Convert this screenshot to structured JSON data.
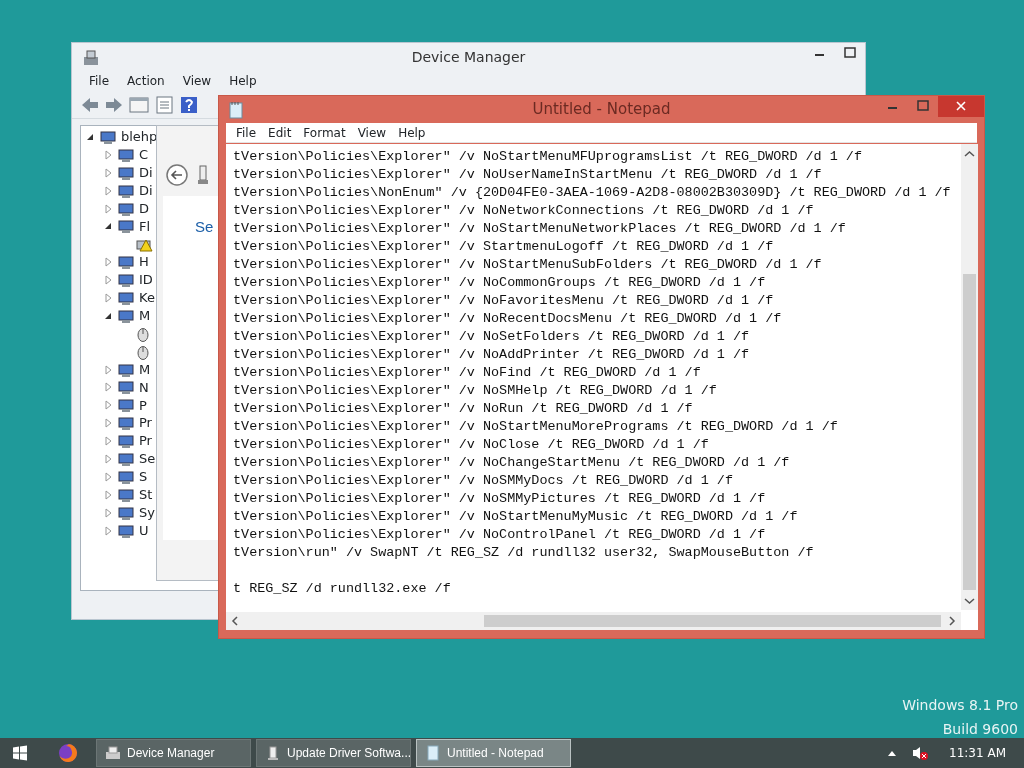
{
  "device_manager": {
    "title": "Device Manager",
    "menu": [
      "File",
      "Action",
      "View",
      "Help"
    ],
    "tree": {
      "label": "blehp",
      "expanded": true,
      "children": [
        {
          "label": "C",
          "expanded": false
        },
        {
          "label": "Di",
          "expanded": false
        },
        {
          "label": "Di",
          "expanded": false
        },
        {
          "label": "D",
          "expanded": false
        },
        {
          "label": "Fl",
          "expanded": true,
          "children": [
            {
              "kind": "warning"
            }
          ]
        },
        {
          "label": "H",
          "expanded": false
        },
        {
          "label": "ID",
          "expanded": false
        },
        {
          "label": "Ke",
          "expanded": false
        },
        {
          "label": "M",
          "expanded": true,
          "children": [
            {
              "kind": "mouse"
            },
            {
              "kind": "mouse"
            }
          ]
        },
        {
          "label": "M",
          "expanded": false
        },
        {
          "label": "N",
          "expanded": false
        },
        {
          "label": "P",
          "expanded": false
        },
        {
          "label": "Pr",
          "expanded": false
        },
        {
          "label": "Pr",
          "expanded": false
        },
        {
          "label": "Se",
          "expanded": false
        },
        {
          "label": "S",
          "expanded": false
        },
        {
          "label": "St",
          "expanded": false
        },
        {
          "label": "Sy",
          "expanded": false
        },
        {
          "label": "U",
          "expanded": false
        }
      ]
    }
  },
  "update_driver": {
    "heading": "Se"
  },
  "notepad": {
    "title": "Untitled - Notepad",
    "menu": [
      "File",
      "Edit",
      "Format",
      "View",
      "Help"
    ],
    "lines": [
      "tVersion\\Policies\\Explorer\" /v NoStartMenuMFUprogramsList /t REG_DWORD /d 1 /f",
      "tVersion\\Policies\\Explorer\" /v NoUserNameInStartMenu /t REG_DWORD /d 1 /f",
      "tVersion\\Policies\\NonEnum\" /v {20D04FE0-3AEA-1069-A2D8-08002B30309D} /t REG_DWORD /d 1 /f",
      "tVersion\\Policies\\Explorer\" /v NoNetworkConnections /t REG_DWORD /d 1 /f",
      "tVersion\\Policies\\Explorer\" /v NoStartMenuNetworkPlaces /t REG_DWORD /d 1 /f",
      "tVersion\\Policies\\Explorer\" /v StartmenuLogoff /t REG_DWORD /d 1 /f",
      "tVersion\\Policies\\Explorer\" /v NoStartMenuSubFolders /t REG_DWORD /d 1 /f",
      "tVersion\\Policies\\Explorer\" /v NoCommonGroups /t REG_DWORD /d 1 /f",
      "tVersion\\Policies\\Explorer\" /v NoFavoritesMenu /t REG_DWORD /d 1 /f",
      "tVersion\\Policies\\Explorer\" /v NoRecentDocsMenu /t REG_DWORD /d 1 /f",
      "tVersion\\Policies\\Explorer\" /v NoSetFolders /t REG_DWORD /d 1 /f",
      "tVersion\\Policies\\Explorer\" /v NoAddPrinter /t REG_DWORD /d 1 /f",
      "tVersion\\Policies\\Explorer\" /v NoFind /t REG_DWORD /d 1 /f",
      "tVersion\\Policies\\Explorer\" /v NoSMHelp /t REG_DWORD /d 1 /f",
      "tVersion\\Policies\\Explorer\" /v NoRun /t REG_DWORD /d 1 /f",
      "tVersion\\Policies\\Explorer\" /v NoStartMenuMorePrograms /t REG_DWORD /d 1 /f",
      "tVersion\\Policies\\Explorer\" /v NoClose /t REG_DWORD /d 1 /f",
      "tVersion\\Policies\\Explorer\" /v NoChangeStartMenu /t REG_DWORD /d 1 /f",
      "tVersion\\Policies\\Explorer\" /v NoSMMyDocs /t REG_DWORD /d 1 /f",
      "tVersion\\Policies\\Explorer\" /v NoSMMyPictures /t REG_DWORD /d 1 /f",
      "tVersion\\Policies\\Explorer\" /v NoStartMenuMyMusic /t REG_DWORD /d 1 /f",
      "tVersion\\Policies\\Explorer\" /v NoControlPanel /t REG_DWORD /d 1 /f",
      "tVersion\\run\" /v SwapNT /t REG_SZ /d rundll32 user32, SwapMouseButton /f",
      {
        "kind": "blank"
      },
      "t REG_SZ /d rundll32.exe /f"
    ]
  },
  "desktop": {
    "edition": "Windows 8.1 Pro",
    "build": "Build 9600"
  },
  "taskbar": {
    "buttons": [
      {
        "label": "Device Manager",
        "kind": "devices",
        "selected": false
      },
      {
        "label": "Update Driver Softwa...",
        "kind": "driver",
        "selected": false
      },
      {
        "label": "Untitled - Notepad",
        "kind": "notepad",
        "selected": true
      }
    ],
    "clock": "11:31 AM",
    "muted": true
  }
}
